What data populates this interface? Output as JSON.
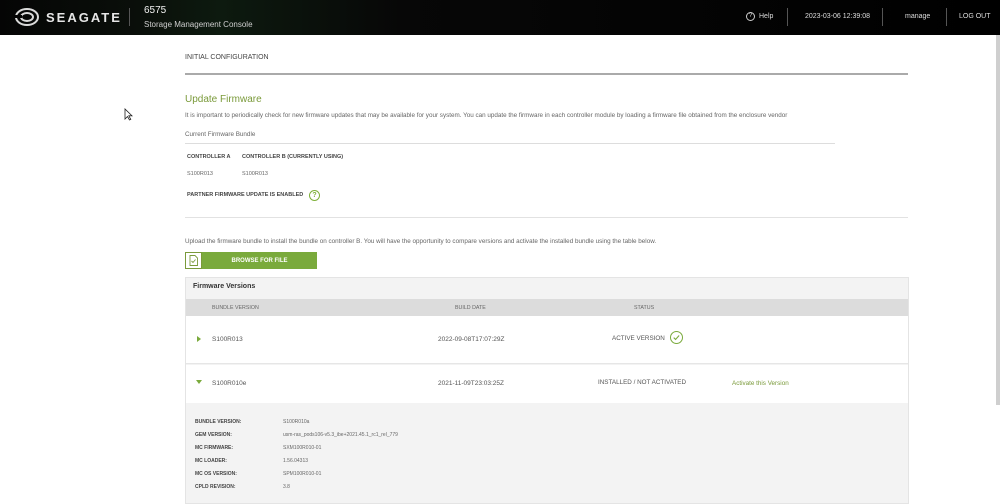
{
  "header": {
    "brand": "SEAGATE",
    "system_number": "6575",
    "system_name": "Storage Management Console",
    "help_label": "Help",
    "datetime": "2023-03-06 12:39:08",
    "user": "manage",
    "logout_label": "LOG OUT"
  },
  "page": {
    "section_title": "INITIAL CONFIGURATION",
    "heading": "Update Firmware",
    "description": "It is important to periodically check for new firmware updates that may be available for your system. You can update the firmware in each controller module by loading a firmware file obtained from the enclosure vendor",
    "current_bundle_label": "Current Firmware Bundle",
    "controller_a_label": "CONTROLLER A",
    "controller_b_label": "CONTROLLER B (CURRENTLY USING)",
    "controller_a_value": "S100R013",
    "controller_b_value": "S100R013",
    "partner_label": "PARTNER FIRMWARE UPDATE IS ENABLED",
    "upload_text": "Upload the firmware bundle to install the bundle on controller B. You will have the opportunity to compare versions and activate the installed bundle using the table below.",
    "browse_label": "BROWSE FOR FILE"
  },
  "firmware_versions": {
    "title": "Firmware Versions",
    "headers": [
      "BUNDLE VERSION",
      "BUILD DATE",
      "STATUS"
    ],
    "rows": [
      {
        "version": "S100R013",
        "build_date": "2022-09-08T17:07:29Z",
        "status": "ACTIVE VERSION",
        "action": ""
      },
      {
        "version": "S100R010e",
        "build_date": "2021-11-09T23:03:25Z",
        "status": "INSTALLED / NOT ACTIVATED",
        "action": "Activate this Version"
      }
    ],
    "details": [
      {
        "label": "BUNDLE VERSION:",
        "value": "S100R010a"
      },
      {
        "label": "GEM VERSION:",
        "value": "usm-ras_pods106-v5.3_ibe+2021.45.1_rc1_rel_779"
      },
      {
        "label": "MC FIRMWARE:",
        "value": "SXM100R010-01"
      },
      {
        "label": "MC LOADER:",
        "value": "1.56.04313"
      },
      {
        "label": "MC OS VERSION:",
        "value": "SPM100R010-01"
      },
      {
        "label": "CPLD REVISION:",
        "value": "3.8"
      }
    ]
  },
  "colors": {
    "accent": "#7aaa3c",
    "accent_text": "#7a9a3a",
    "topbar": "#000000"
  }
}
